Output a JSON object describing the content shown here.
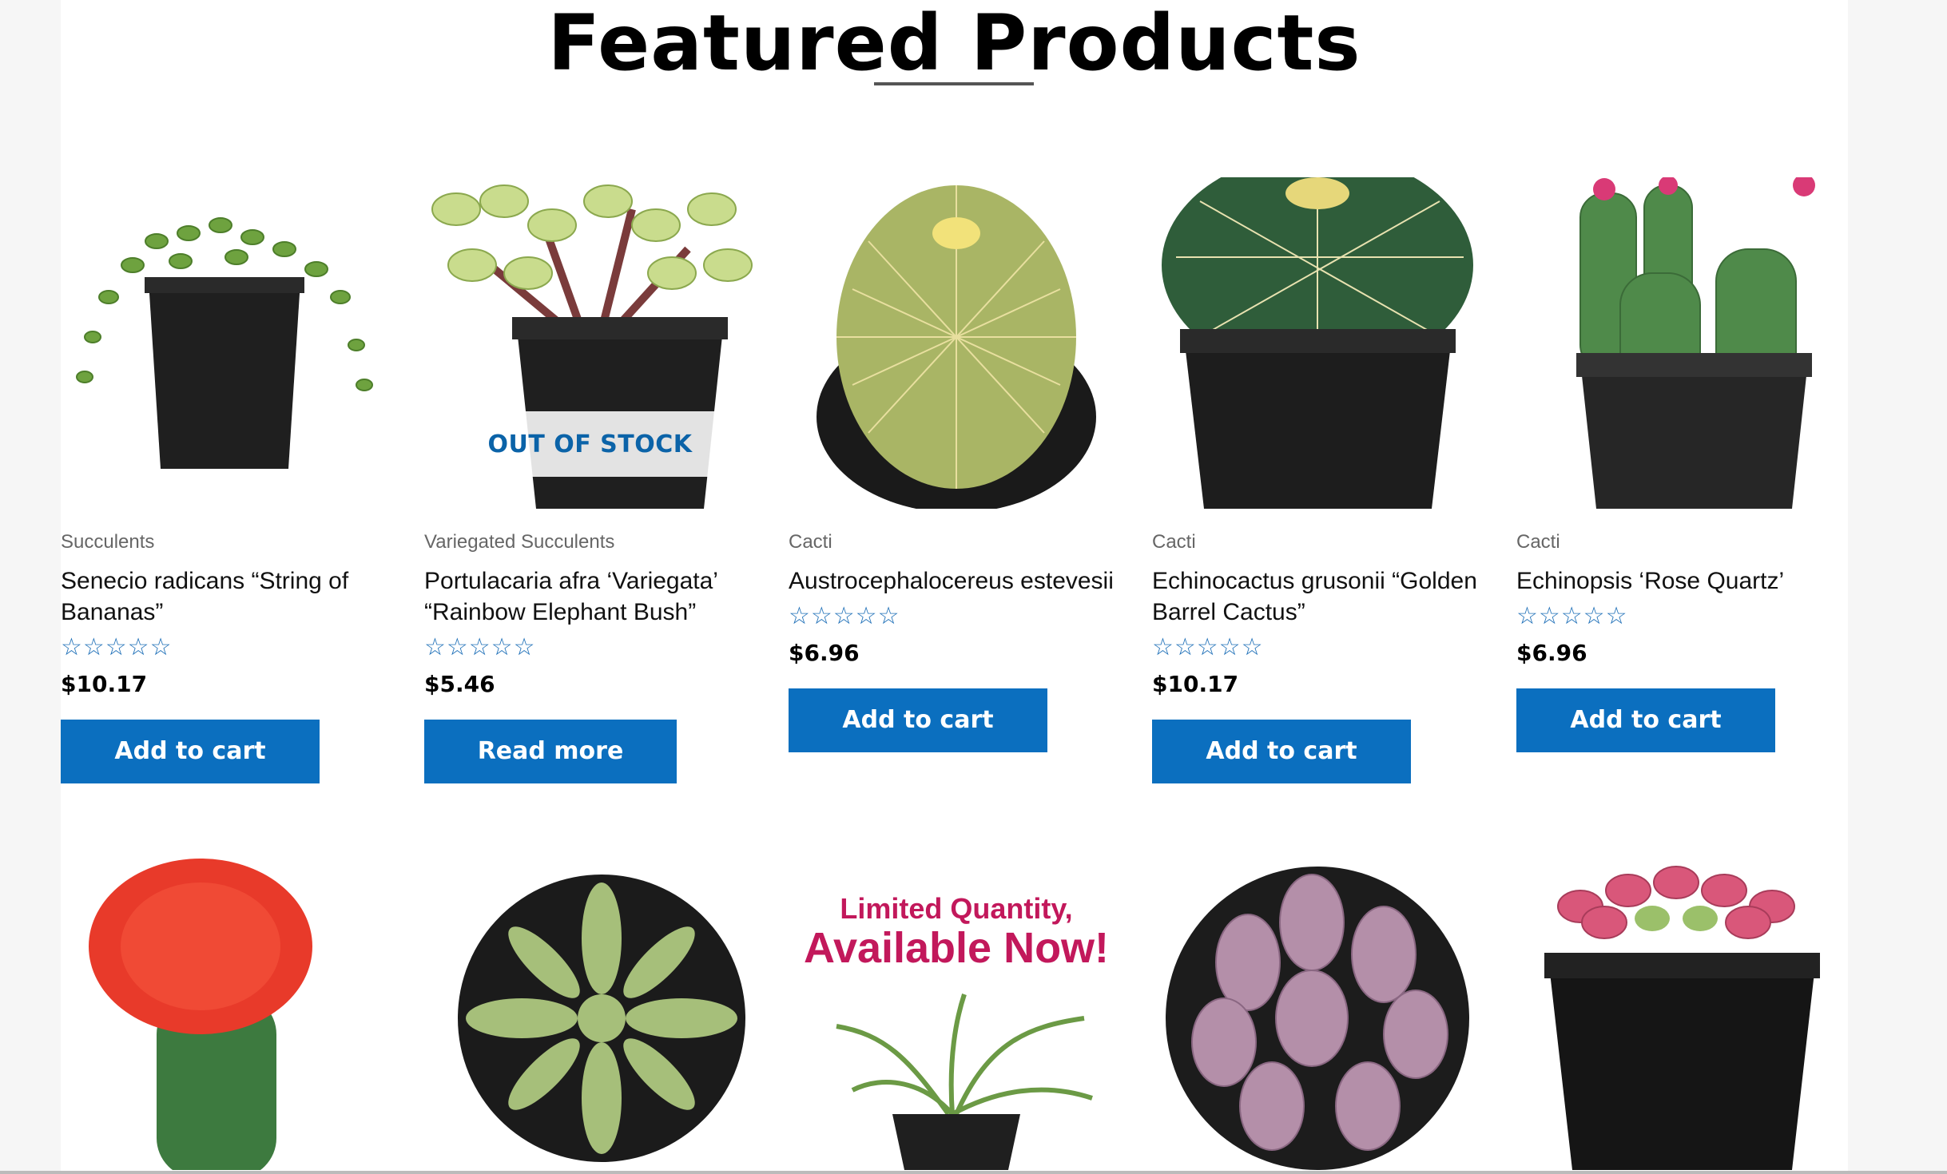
{
  "heading": "Featured Products",
  "products": [
    {
      "category": "Succulents",
      "name": "Senecio radicans “String of Bananas”",
      "rating": "☆☆☆☆☆",
      "price": "$10.17",
      "button": "Add to cart",
      "image": "string-of-bananas-plant"
    },
    {
      "category": "Variegated Succulents",
      "name": "Portulacaria afra ‘Variegata’ “Rainbow Elephant Bush”",
      "rating": "☆☆☆☆☆",
      "price": "$5.46",
      "button": "Read more",
      "badge": "OUT OF STOCK",
      "image": "elephant-bush-plant"
    },
    {
      "category": "Cacti",
      "name": "Austrocephalocereus estevesii",
      "rating": "☆☆☆☆☆",
      "price": "$6.96",
      "button": "Add to cart",
      "image": "golden-spine-cactus"
    },
    {
      "category": "Cacti",
      "name": "Echinocactus grusonii “Golden Barrel Cactus”",
      "rating": "☆☆☆☆☆",
      "price": "$10.17",
      "button": "Add to cart",
      "image": "golden-barrel-cactus"
    },
    {
      "category": "Cacti",
      "name": "Echinopsis ‘Rose Quartz’",
      "rating": "☆☆☆☆☆",
      "price": "$6.96",
      "button": "Add to cart",
      "image": "rose-quartz-cactus"
    }
  ],
  "row2": [
    {
      "image": "red-moon-cactus"
    },
    {
      "image": "euphorbia-star"
    },
    {
      "image": "dolphin-succulent",
      "overlay_line1": "Limited Quantity,",
      "overlay_line2": "Available Now!"
    },
    {
      "image": "pink-pachyphytum"
    },
    {
      "image": "pink-sedum"
    }
  ],
  "colors": {
    "accent": "#0b6fbf",
    "star": "#1f70b8",
    "badge_text": "#0b63a8"
  }
}
